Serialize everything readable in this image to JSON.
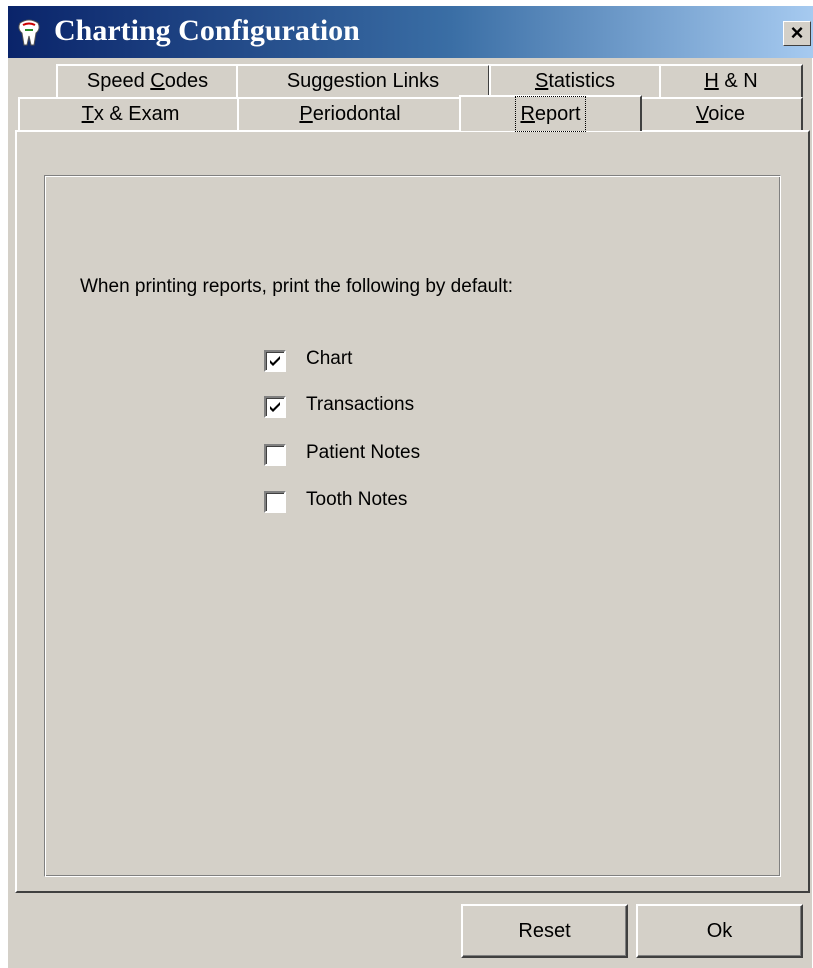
{
  "window": {
    "title": "Charting Configuration",
    "close_label": "×"
  },
  "tabs": {
    "row1": [
      {
        "label": "Speed Codes",
        "pre": "Speed ",
        "ul": "C",
        "post": "odes"
      },
      {
        "label": "Suggestion Links",
        "pre": "Suggestion Links",
        "ul": "",
        "post": ""
      },
      {
        "label": "Statistics",
        "pre": "",
        "ul": "S",
        "post": "tatistics"
      },
      {
        "label": "H & N",
        "pre": "",
        "ul": "H",
        "post": " & N"
      }
    ],
    "row2": [
      {
        "label": "Tx & Exam",
        "pre": "",
        "ul": "T",
        "post": "x & Exam"
      },
      {
        "label": "Periodontal",
        "pre": "",
        "ul": "P",
        "post": "eriodontal"
      },
      {
        "label": "Report",
        "pre": "",
        "ul": "R",
        "post": "eport"
      },
      {
        "label": "Voice",
        "pre": "",
        "ul": "V",
        "post": "oice"
      }
    ],
    "selected": "Report"
  },
  "report": {
    "prompt": "When printing reports, print the following by default:",
    "options": [
      {
        "label": "Chart",
        "checked": true
      },
      {
        "label": "Transactions",
        "checked": true
      },
      {
        "label": "Patient Notes",
        "checked": false
      },
      {
        "label": "Tooth Notes",
        "checked": false
      }
    ]
  },
  "buttons": {
    "reset": "Reset",
    "ok": "Ok"
  },
  "colors": {
    "face": "#d4d0c8",
    "title_start": "#0a246a",
    "title_end": "#a6caf0"
  },
  "icons": {
    "app": "tooth-app-icon",
    "close": "close-icon",
    "check": "checkmark-icon"
  }
}
